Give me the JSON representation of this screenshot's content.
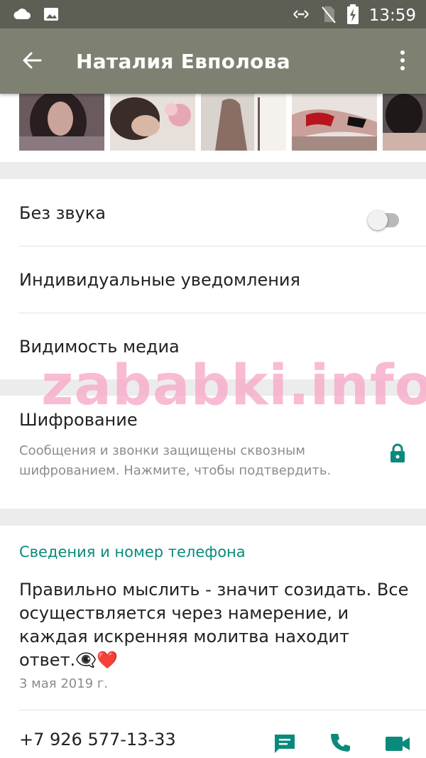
{
  "status_bar": {
    "time": "13:59",
    "icons": [
      "cloud-icon",
      "image-icon",
      "data-sync-icon",
      "no-sim-icon",
      "battery-charging-icon"
    ]
  },
  "app_bar": {
    "title": "Наталия Евполова",
    "back_icon": "arrow-left-icon",
    "menu_icon": "more-vert-icon"
  },
  "settings": {
    "mute_label": "Без звука",
    "mute_enabled": false,
    "custom_notifications_label": "Индивидуальные уведомления",
    "media_visibility_label": "Видимость медиа"
  },
  "encryption": {
    "title": "Шифрование",
    "description": "Сообщения и звонки защищены сквозным шифрованием. Нажмите, чтобы подтвердить.",
    "icon": "lock-icon"
  },
  "about": {
    "header": "Сведения и номер телефона",
    "text": "Правильно мыслить - значит созидать. Все осуществляется через намерение, и каждая искренняя молитва находит ответ.👁️‍🗨️❤️",
    "date": "3 мая 2019 г.",
    "phone": "+7 926 577-13-33",
    "actions": [
      "message-icon",
      "phone-icon",
      "video-call-icon"
    ]
  },
  "watermark": "zababki.info",
  "colors": {
    "status_bar": "#5d5f55",
    "app_bar": "#7e8172",
    "accent": "#0b8a7b",
    "watermark": "#f7a8c8"
  }
}
